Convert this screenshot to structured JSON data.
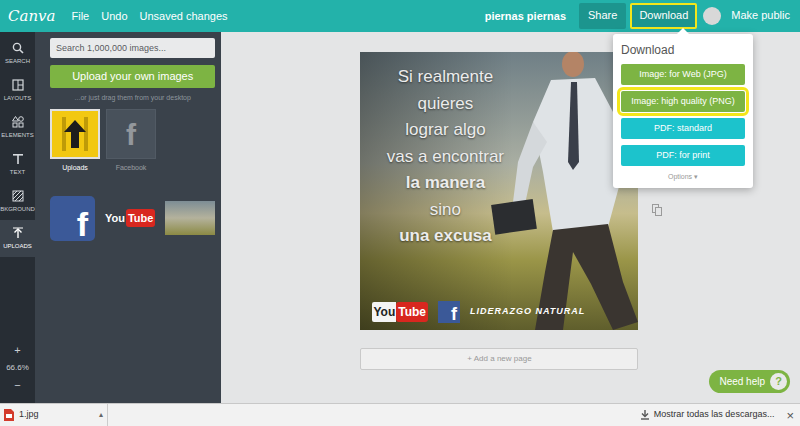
{
  "topbar": {
    "logo": "Canva",
    "menu": [
      "File",
      "Undo",
      "Unsaved changes"
    ],
    "doc_title": "piernas piernas",
    "share": "Share",
    "download": {
      "label": "Download",
      "highlighted": true
    },
    "make_public": "Make public"
  },
  "rail": {
    "items": [
      {
        "label": "SEARCH",
        "kind": "search",
        "selected": false
      },
      {
        "label": "LAYOUTS",
        "kind": "layouts",
        "selected": false
      },
      {
        "label": "ELEMENTS",
        "kind": "elements",
        "selected": false
      },
      {
        "label": "TEXT",
        "kind": "text",
        "selected": false
      },
      {
        "label": "BKGROUND",
        "kind": "background",
        "selected": false
      },
      {
        "label": "UPLOADS",
        "kind": "uploads",
        "selected": true
      }
    ],
    "zoom_in": "+",
    "zoom": "66.6%",
    "zoom_out": "−"
  },
  "panel": {
    "search": {
      "placeholder": "Search 1,000,000 images..."
    },
    "upload_button": "Upload your own images",
    "hint": "...or just drag them from your desktop",
    "folders": [
      {
        "label": "Uploads",
        "kind": "uploads",
        "selected": true
      },
      {
        "label": "Facebook",
        "kind": "facebook",
        "glyph": "f",
        "selected": false
      }
    ],
    "images": [
      {
        "kind": "facebook",
        "glyph": "f"
      },
      {
        "kind": "youtube",
        "parts": [
          "You",
          "Tube"
        ]
      },
      {
        "kind": "photo"
      }
    ]
  },
  "design": {
    "lines": [
      {
        "text": "Si realmente",
        "bold": false
      },
      {
        "text": "quieres",
        "bold": false
      },
      {
        "text": "lograr algo",
        "bold": false
      },
      {
        "text": "vas a encontrar",
        "bold": false
      },
      {
        "text": "la manera",
        "bold": true
      },
      {
        "text": "sino",
        "bold": false
      },
      {
        "text": "una excusa",
        "bold": true
      }
    ],
    "logos": [
      {
        "kind": "youtube",
        "parts": [
          "You",
          "Tube"
        ]
      },
      {
        "kind": "facebook",
        "glyph": "f"
      }
    ],
    "signature": "LIDERAZGO NATURAL"
  },
  "add_page": "+ Add a new page",
  "download_menu": {
    "title": "Download",
    "options": [
      {
        "label": "Image: for Web (JPG)",
        "kind": "image",
        "highlighted": false
      },
      {
        "label": "Image: high quality (PNG)",
        "kind": "image",
        "highlighted": true
      },
      {
        "label": "PDF: standard",
        "kind": "pdf",
        "highlighted": false
      },
      {
        "label": "PDF: for print",
        "kind": "pdf",
        "highlighted": false
      }
    ],
    "more": "Options",
    "more_caret": "▾"
  },
  "help": {
    "label": "Need help",
    "glyph": "?"
  },
  "downloads_bar": {
    "file": {
      "name": "1.jpg",
      "caret": "▴"
    },
    "show_all": "Mostrar todas las descargas...",
    "close": "×"
  }
}
